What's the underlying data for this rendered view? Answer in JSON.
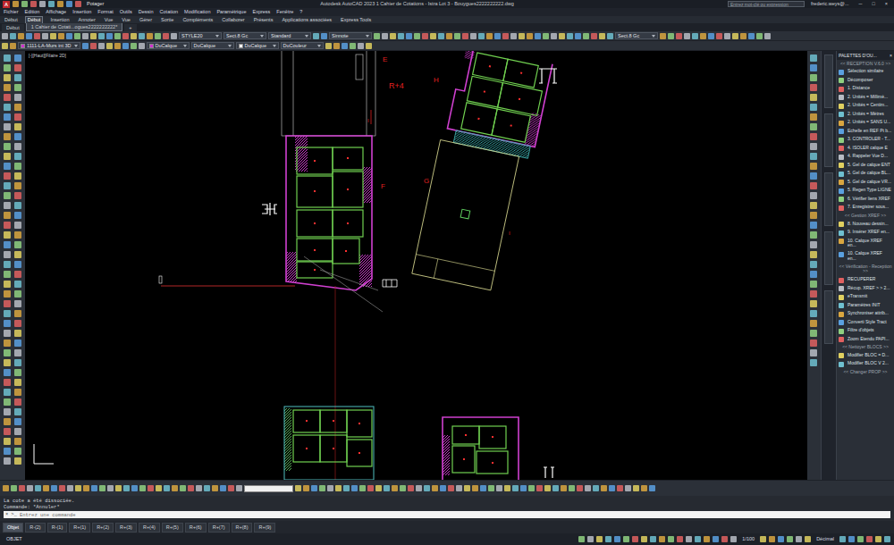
{
  "window": {
    "app_menu": "A",
    "quick_workspace": "Potager",
    "title": "Autodesk AutoCAD 2023   1 Cahier de Cotations - Istra Lot 3 - Bouygues2222222222.dwg",
    "search": {
      "placeholder": "Entrez mot-clé ou expression"
    },
    "user": "frederic.weys@...",
    "controls": [
      "─",
      "□",
      "×"
    ]
  },
  "menu": [
    "Fichier",
    "Edition",
    "Affichage",
    "Insertion",
    "Format",
    "Outils",
    "Dessin",
    "Cotation",
    "Modification",
    "Paramétrique",
    "Express",
    "Fenêtre",
    "?"
  ],
  "ribbon_tabs": [
    {
      "label": "Début",
      "selected": false
    },
    {
      "label": "Début",
      "selected": true
    },
    {
      "label": "Insertion",
      "selected": false
    },
    {
      "label": "Annoter",
      "selected": false
    },
    {
      "label": "Vue",
      "selected": false
    },
    {
      "label": "Vue",
      "selected": false
    },
    {
      "label": "Gérer",
      "selected": false
    },
    {
      "label": "Sortie",
      "selected": false
    },
    {
      "label": "Compléments",
      "selected": false
    },
    {
      "label": "Collaborer",
      "selected": false
    },
    {
      "label": "Présents",
      "selected": false
    },
    {
      "label": "Applications associées",
      "selected": false
    },
    {
      "label": "Express Tools",
      "selected": false
    }
  ],
  "file_tabs": {
    "tabs": [
      {
        "label": "Début",
        "selected": false
      },
      {
        "label": "1 Cahier de Cotati...ogues2222222222*",
        "selected": true
      }
    ],
    "new_tab": "+"
  },
  "toolbar": {
    "row1": [
      {
        "label": "STYLE20"
      },
      {
        "label": "Sect.8 Gc"
      },
      {
        "label": "Standard"
      },
      {
        "label": "Sinnote"
      },
      {
        "label": "Sect.8 Gc"
      }
    ],
    "row2": [
      {
        "label": "1111-LA-Murs int 3D",
        "color": "#d030d0"
      },
      {
        "label": "DuCalque",
        "color": "#d030d0"
      },
      {
        "label": "DuCalque"
      },
      {
        "label": "DuCalque",
        "color": "#ffffff"
      },
      {
        "label": "DuCouleur"
      }
    ]
  },
  "viewport": {
    "label": "[-][Haut][Filaire 2D]",
    "labels": [
      "E",
      "R+4",
      "H",
      "F",
      "G",
      "I",
      "I"
    ]
  },
  "palette": {
    "title": "PALETTES D'OU...",
    "close": "×",
    "items": [
      {
        "label": "<< RECEPTION V.6.0 >>",
        "kind": "section"
      },
      {
        "label": "Sélection similaire",
        "kind": "tool"
      },
      {
        "label": "Décomposer",
        "kind": "tool"
      },
      {
        "label": "1. Distance",
        "kind": "tool"
      },
      {
        "label": "2. Unités = Millimè...",
        "kind": "tool"
      },
      {
        "label": "2. Unités = Centim...",
        "kind": "tool"
      },
      {
        "label": "2. Unités = Mètres",
        "kind": "tool"
      },
      {
        "label": "2. Unités = SANS U...",
        "kind": "tool"
      },
      {
        "label": "Echelle en REF Pt b...",
        "kind": "tool"
      },
      {
        "label": "3. CONTROLER - T...",
        "kind": "tool"
      },
      {
        "label": "4. ISOLER calque E",
        "kind": "tool"
      },
      {
        "label": "4. Rappeler Vue D...",
        "kind": "tool"
      },
      {
        "label": "5. Gel de calque ENT",
        "kind": "tool"
      },
      {
        "label": "5. Gel de calque BL...",
        "kind": "tool"
      },
      {
        "label": "5. Gel de calque VR...",
        "kind": "tool"
      },
      {
        "label": "5. Regen Type LIGNE",
        "kind": "tool"
      },
      {
        "label": "6. Vérifier liens XREF",
        "kind": "tool"
      },
      {
        "label": "7. Enregistrer sous...",
        "kind": "tool"
      },
      {
        "label": "<< Gestion XREF >>",
        "kind": "section"
      },
      {
        "label": "8. Nouveau dessin...",
        "kind": "tool"
      },
      {
        "label": "9. Insérer XREF en...",
        "kind": "tool"
      },
      {
        "label": "10. Calque XREF en...",
        "kind": "tool"
      },
      {
        "label": "10. Calque XREF en...",
        "kind": "tool"
      },
      {
        "label": "<< Vérification - Reception >>",
        "kind": "section"
      },
      {
        "label": "RECUPERER",
        "kind": "tool"
      },
      {
        "label": "Récup. XREF > > 2...",
        "kind": "tool"
      },
      {
        "label": "eTransmit",
        "kind": "tool"
      },
      {
        "label": "Paramètres INIT",
        "kind": "tool"
      },
      {
        "label": "Synchroniser attrib...",
        "kind": "tool"
      },
      {
        "label": "Converti Style Tract",
        "kind": "tool"
      },
      {
        "label": "Filtre d'objets",
        "kind": "tool"
      },
      {
        "label": "Zoom Etendu PAPI...",
        "kind": "tool"
      },
      {
        "label": "<< Nettoyer BLOCS >>",
        "kind": "section"
      },
      {
        "label": "Modifier BLOC = D...",
        "kind": "tool"
      },
      {
        "label": "Modifier BLOC V 2...",
        "kind": "tool"
      },
      {
        "label": "<< Changer PROP >>",
        "kind": "section"
      }
    ]
  },
  "command": {
    "history": [
      "La cote a été dissociée.",
      "Commande: *Annuler*"
    ],
    "close": "×",
    "prompt": ">_",
    "placeholder": "Entrez une commande"
  },
  "layout_tabs": [
    {
      "label": "Objet",
      "selected": true
    },
    {
      "label": "R-(2)",
      "selected": false
    },
    {
      "label": "R-(1)",
      "selected": false
    },
    {
      "label": "R+(1)",
      "selected": false
    },
    {
      "label": "R+(2)",
      "selected": false
    },
    {
      "label": "R+(3)",
      "selected": false
    },
    {
      "label": "R+(4)",
      "selected": false
    },
    {
      "label": "R+(5)",
      "selected": false
    },
    {
      "label": "R+(6)",
      "selected": false
    },
    {
      "label": "R+(7)",
      "selected": false
    },
    {
      "label": "R+(8)",
      "selected": false
    },
    {
      "label": "R+(9)",
      "selected": false
    }
  ],
  "status": {
    "model": "OBJET",
    "scale": "1/100",
    "units": "Décimal"
  }
}
